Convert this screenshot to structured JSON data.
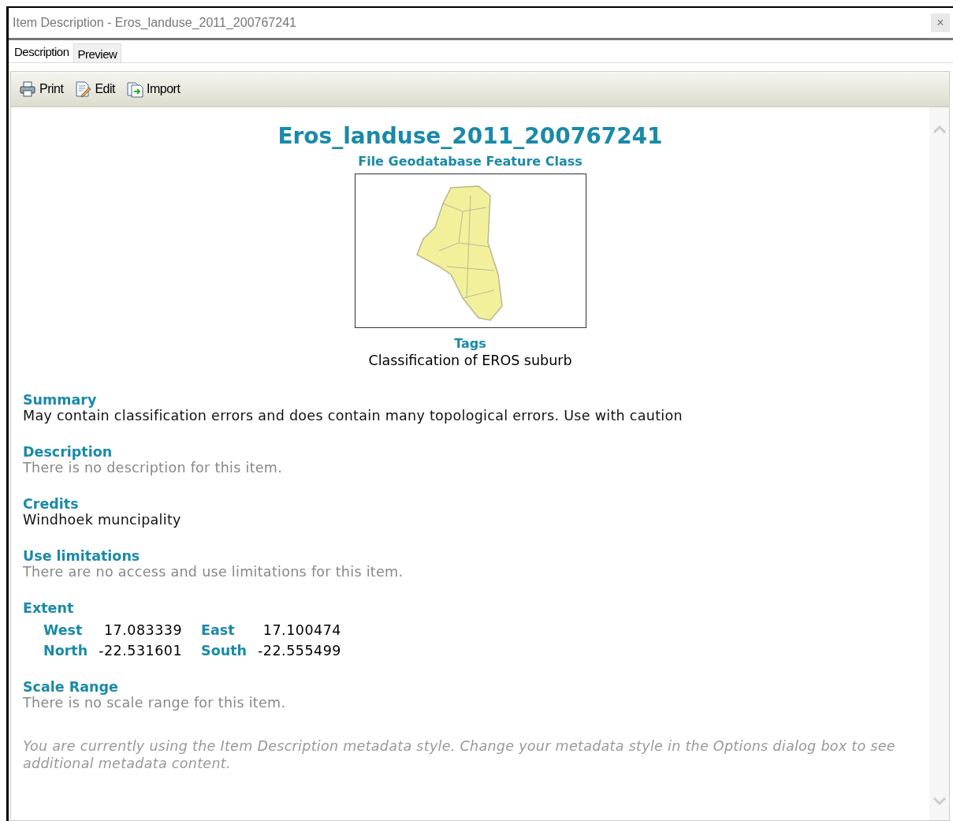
{
  "window": {
    "title": "Item Description - Eros_landuse_2011_200767241",
    "close": "×"
  },
  "tabs": [
    {
      "label": "Description",
      "selected": true
    },
    {
      "label": "Preview",
      "selected": false
    }
  ],
  "toolbar": [
    {
      "label": "Print",
      "kind": "print"
    },
    {
      "label": "Edit",
      "kind": "edit"
    },
    {
      "label": "Import",
      "kind": "import"
    }
  ],
  "item": {
    "name": "Eros_landuse_2011_200767241",
    "type": "File Geodatabase Feature Class",
    "tags_heading": "Tags",
    "tags": "Classification of EROS suburb"
  },
  "sections": [
    {
      "kind": "text",
      "heading": "Summary",
      "text": "May contain classification errors and does contain many topological errors. Use with caution",
      "muted": false
    },
    {
      "kind": "text",
      "heading": "Description",
      "text": "There is no description for this item.",
      "muted": true
    },
    {
      "kind": "text",
      "heading": "Credits",
      "text": "Windhoek muncipality",
      "muted": false
    },
    {
      "kind": "text",
      "heading": "Use limitations",
      "text": "There are no access and use limitations for this item.",
      "muted": true
    },
    {
      "kind": "extent",
      "heading": "Extent",
      "rows": [
        [
          {
            "label": "West",
            "value": "17.083339"
          },
          {
            "label": "East",
            "value": "17.100474"
          }
        ],
        [
          {
            "label": "North",
            "value": "-22.531601"
          },
          {
            "label": "South",
            "value": "-22.555499"
          }
        ]
      ]
    },
    {
      "kind": "text",
      "heading": "Scale Range",
      "text": "There is no scale range for this item.",
      "muted": true
    }
  ],
  "footnote": "You are currently using the Item Description metadata style. Change your metadata style in the Options dialog box to see additional metadata content."
}
